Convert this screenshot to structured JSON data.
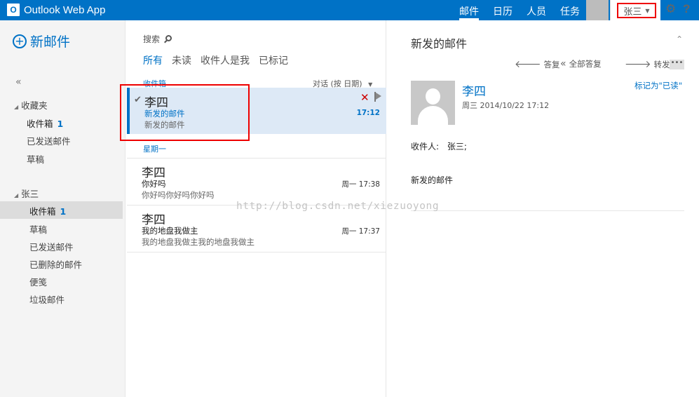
{
  "app": {
    "logo_glyph": "O",
    "title": "Outlook Web App",
    "nav": [
      {
        "label": "邮件"
      },
      {
        "label": "日历"
      },
      {
        "label": "人员"
      },
      {
        "label": "任务"
      }
    ],
    "user": "张三",
    "icons": {
      "settings": "gear-icon",
      "help": "help-icon"
    }
  },
  "sidebar": {
    "new_mail": "新邮件",
    "collapse": "«",
    "favorites": {
      "label": "收藏夹",
      "items": [
        {
          "label": "收件箱",
          "count": "1"
        },
        {
          "label": "已发送邮件"
        },
        {
          "label": "草稿"
        }
      ]
    },
    "account": {
      "label": "张三",
      "items": [
        {
          "label": "收件箱",
          "count": "1",
          "selected": true
        },
        {
          "label": "草稿"
        },
        {
          "label": "已发送邮件"
        },
        {
          "label": "已删除的邮件"
        },
        {
          "label": "便笺"
        },
        {
          "label": "垃圾邮件"
        }
      ]
    }
  },
  "list": {
    "search_label": "搜索",
    "filters": [
      "所有",
      "未读",
      "收件人是我",
      "已标记"
    ],
    "folder": "收件箱",
    "sort": "对话 (按 日期)",
    "day_header": "星期一",
    "messages": [
      {
        "sender": "李四",
        "subject": "新发的邮件",
        "preview": "新发的邮件",
        "time": "17:12",
        "unread": true,
        "selected": true
      },
      {
        "sender": "李四",
        "subject": "你好吗",
        "preview": "你好吗你好吗你好吗",
        "time": "周一 17:38"
      },
      {
        "sender": "李四",
        "subject": "我的地盘我做主",
        "preview": "我的地盘我做主我的地盘我做主",
        "time": "周一 17:37"
      }
    ]
  },
  "reading": {
    "title": "新发的邮件",
    "actions": {
      "reply": "答复",
      "reply_all": "全部答复",
      "forward": "转发",
      "more": "•••"
    },
    "sender": "李四",
    "date": "周三 2014/10/22 17:12",
    "mark_read": "标记为\"已读\"",
    "recipients_label": "收件人:",
    "recipients": "张三;",
    "body": "新发的邮件"
  },
  "watermark": "http://blog.csdn.net/xiezuoyong",
  "colors": {
    "accent": "#0072c6",
    "highlight": "#dde9f6",
    "annotation": "#ee0000"
  }
}
